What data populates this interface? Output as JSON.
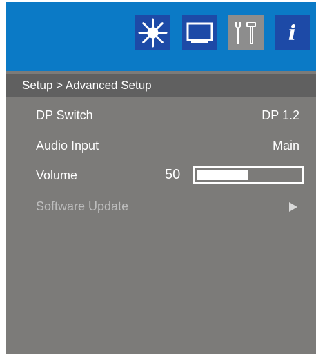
{
  "tabs": [
    {
      "icon": "brightness-icon",
      "active": false
    },
    {
      "icon": "display-icon",
      "active": false
    },
    {
      "icon": "setup-tools-icon",
      "active": true
    },
    {
      "icon": "info-icon",
      "active": false
    }
  ],
  "info_tab_glyph": "i",
  "breadcrumb": "Setup > Advanced Setup",
  "menu": {
    "dp_switch": {
      "label": "DP Switch",
      "value": "DP 1.2"
    },
    "audio_input": {
      "label": "Audio Input",
      "value": "Main"
    },
    "volume": {
      "label": "Volume",
      "value": "50",
      "level_percent": 50
    },
    "software_update": {
      "label": "Software Update",
      "enabled": false
    }
  },
  "colors": {
    "header": "#0b7ac6",
    "tab_inactive": "#1d4aa7",
    "tab_active": "#8d8d8d",
    "panel": "#7c7b79",
    "breadcrumb_bar": "#606060",
    "disabled_text": "#bdbdbd"
  }
}
